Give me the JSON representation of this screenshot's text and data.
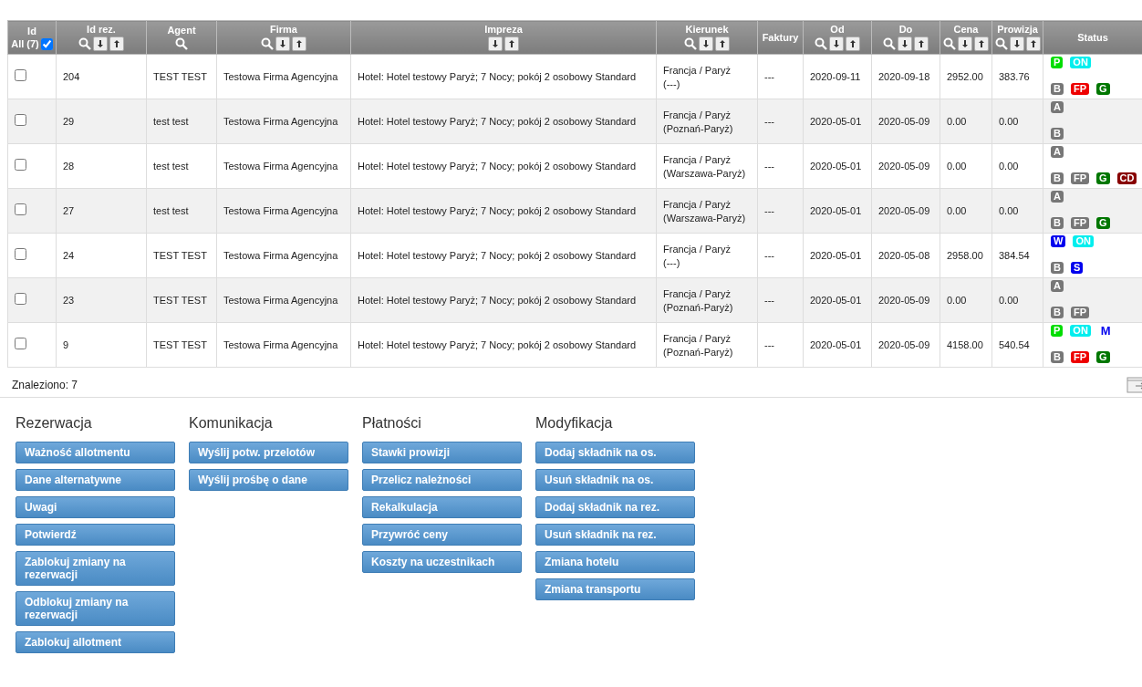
{
  "table": {
    "columns": [
      {
        "title": "Id",
        "all_label": "All (7)",
        "all_checked": true,
        "search": false,
        "sort": false
      },
      {
        "title": "Id rez.",
        "search": true,
        "sort": true
      },
      {
        "title": "Agent",
        "search": true,
        "sort": false
      },
      {
        "title": "Firma",
        "search": true,
        "sort": true
      },
      {
        "title": "Impreza",
        "search": false,
        "sort": true
      },
      {
        "title": "Kierunek",
        "search": true,
        "sort": true
      },
      {
        "title": "Faktury",
        "search": false,
        "sort": false
      },
      {
        "title": "Od",
        "search": true,
        "sort": true
      },
      {
        "title": "Do",
        "search": true,
        "sort": true
      },
      {
        "title": "Cena",
        "search": true,
        "sort": true
      },
      {
        "title": "Prowizja",
        "search": true,
        "sort": true
      },
      {
        "title": "Status",
        "search": false,
        "sort": false
      }
    ],
    "rows": [
      {
        "checked": false,
        "id": "204",
        "agent": "TEST TEST",
        "firma": "Testowa Firma Agencyjna",
        "impreza": "Hotel: Hotel testowy Paryż; 7 Nocy; pokój 2 osobowy Standard",
        "kierunek": [
          "Francja / Paryż",
          "(---)"
        ],
        "faktury": "---",
        "od": "2020-09-11",
        "do": "2020-09-18",
        "cena": "2952.00",
        "prowizja": "383.76",
        "status": [
          [
            {
              "label": "P",
              "kind": "fill",
              "color": "#00dd00"
            },
            {
              "label": "ON",
              "kind": "fill",
              "color": "#00eeee"
            }
          ],
          [
            {
              "label": "B",
              "kind": "fill",
              "color": "#777777"
            },
            {
              "label": "FP",
              "kind": "fill",
              "color": "#ee0000"
            },
            {
              "label": "G",
              "kind": "fill",
              "color": "#007700"
            }
          ]
        ]
      },
      {
        "checked": false,
        "id": "29",
        "agent": "test test",
        "firma": "Testowa Firma Agencyjna",
        "impreza": "Hotel: Hotel testowy Paryż; 7 Nocy; pokój 2 osobowy Standard",
        "kierunek": [
          "Francja / Paryż",
          "(Poznań-Paryż)"
        ],
        "faktury": "---",
        "od": "2020-05-01",
        "do": "2020-05-09",
        "cena": "0.00",
        "prowizja": "0.00",
        "status": [
          [
            {
              "label": "A",
              "kind": "fill",
              "color": "#777777"
            }
          ],
          [
            {
              "label": "B",
              "kind": "fill",
              "color": "#777777"
            }
          ]
        ]
      },
      {
        "checked": false,
        "id": "28",
        "agent": "test test",
        "firma": "Testowa Firma Agencyjna",
        "impreza": "Hotel: Hotel testowy Paryż; 7 Nocy; pokój 2 osobowy Standard",
        "kierunek": [
          "Francja / Paryż",
          "(Warszawa-Paryż)"
        ],
        "faktury": "---",
        "od": "2020-05-01",
        "do": "2020-05-09",
        "cena": "0.00",
        "prowizja": "0.00",
        "status": [
          [
            {
              "label": "A",
              "kind": "fill",
              "color": "#777777"
            }
          ],
          [
            {
              "label": "B",
              "kind": "fill",
              "color": "#777777"
            },
            {
              "label": "FP",
              "kind": "fill",
              "color": "#777777"
            },
            {
              "label": "G",
              "kind": "fill",
              "color": "#007700"
            },
            {
              "label": "CD",
              "kind": "fill",
              "color": "#880000"
            }
          ]
        ]
      },
      {
        "checked": false,
        "id": "27",
        "agent": "test test",
        "firma": "Testowa Firma Agencyjna",
        "impreza": "Hotel: Hotel testowy Paryż; 7 Nocy; pokój 2 osobowy Standard",
        "kierunek": [
          "Francja / Paryż",
          "(Warszawa-Paryż)"
        ],
        "faktury": "---",
        "od": "2020-05-01",
        "do": "2020-05-09",
        "cena": "0.00",
        "prowizja": "0.00",
        "status": [
          [
            {
              "label": "A",
              "kind": "fill",
              "color": "#777777"
            }
          ],
          [
            {
              "label": "B",
              "kind": "fill",
              "color": "#777777"
            },
            {
              "label": "FP",
              "kind": "fill",
              "color": "#777777"
            },
            {
              "label": "G",
              "kind": "fill",
              "color": "#007700"
            }
          ]
        ]
      },
      {
        "checked": false,
        "id": "24",
        "agent": "TEST TEST",
        "firma": "Testowa Firma Agencyjna",
        "impreza": "Hotel: Hotel testowy Paryż; 7 Nocy; pokój 2 osobowy Standard",
        "kierunek": [
          "Francja / Paryż",
          "(---)"
        ],
        "faktury": "---",
        "od": "2020-05-01",
        "do": "2020-05-08",
        "cena": "2958.00",
        "prowizja": "384.54",
        "status": [
          [
            {
              "label": "W",
              "kind": "fill",
              "color": "#0000ee"
            },
            {
              "label": "ON",
              "kind": "fill",
              "color": "#00eeee"
            }
          ],
          [
            {
              "label": "B",
              "kind": "fill",
              "color": "#777777"
            },
            {
              "label": "S",
              "kind": "fill",
              "color": "#0000ee"
            }
          ]
        ]
      },
      {
        "checked": false,
        "id": "23",
        "agent": "TEST TEST",
        "firma": "Testowa Firma Agencyjna",
        "impreza": "Hotel: Hotel testowy Paryż; 7 Nocy; pokój 2 osobowy Standard",
        "kierunek": [
          "Francja / Paryż",
          "(Poznań-Paryż)"
        ],
        "faktury": "---",
        "od": "2020-05-01",
        "do": "2020-05-09",
        "cena": "0.00",
        "prowizja": "0.00",
        "status": [
          [
            {
              "label": "A",
              "kind": "fill",
              "color": "#777777"
            }
          ],
          [
            {
              "label": "B",
              "kind": "fill",
              "color": "#777777"
            },
            {
              "label": "FP",
              "kind": "fill",
              "color": "#777777"
            }
          ]
        ]
      },
      {
        "checked": false,
        "id": "9",
        "agent": "TEST TEST",
        "firma": "Testowa Firma Agencyjna",
        "impreza": "Hotel: Hotel testowy Paryż; 7 Nocy; pokój 2 osobowy Standard",
        "kierunek": [
          "Francja / Paryż",
          "(Poznań-Paryż)"
        ],
        "faktury": "---",
        "od": "2020-05-01",
        "do": "2020-05-09",
        "cena": "4158.00",
        "prowizja": "540.54",
        "status": [
          [
            {
              "label": "P",
              "kind": "fill",
              "color": "#00dd00"
            },
            {
              "label": "ON",
              "kind": "fill",
              "color": "#00eeee"
            },
            {
              "label": "M",
              "kind": "text",
              "color": "#0000ee"
            }
          ],
          [
            {
              "label": "B",
              "kind": "fill",
              "color": "#777777"
            },
            {
              "label": "FP",
              "kind": "fill",
              "color": "#ee0000"
            },
            {
              "label": "G",
              "kind": "fill",
              "color": "#007700"
            }
          ]
        ]
      }
    ]
  },
  "found": "Znaleziono: 7",
  "sections": [
    {
      "title": "Rezerwacja",
      "buttons": [
        "Ważność allotmentu",
        "Dane alternatywne",
        "Uwagi",
        "Potwierdź",
        "Zablokuj zmiany na rezerwacji",
        "Odblokuj zmiany na rezerwacji",
        "Zablokuj allotment"
      ]
    },
    {
      "title": "Komunikacja",
      "buttons": [
        "Wyślij potw. przelotów",
        "Wyślij prośbę o dane"
      ]
    },
    {
      "title": "Płatności",
      "buttons": [
        "Stawki prowizji",
        "Przelicz należności",
        "Rekalkulacja",
        "Przywróć ceny",
        "Koszty na uczestnikach"
      ]
    },
    {
      "title": "Modyfikacja",
      "buttons": [
        "Dodaj składnik na os.",
        "Usuń składnik na os.",
        "Dodaj składnik na rez.",
        "Usuń składnik na rez.",
        "Zmiana hotelu",
        "Zmiana transportu"
      ]
    }
  ]
}
